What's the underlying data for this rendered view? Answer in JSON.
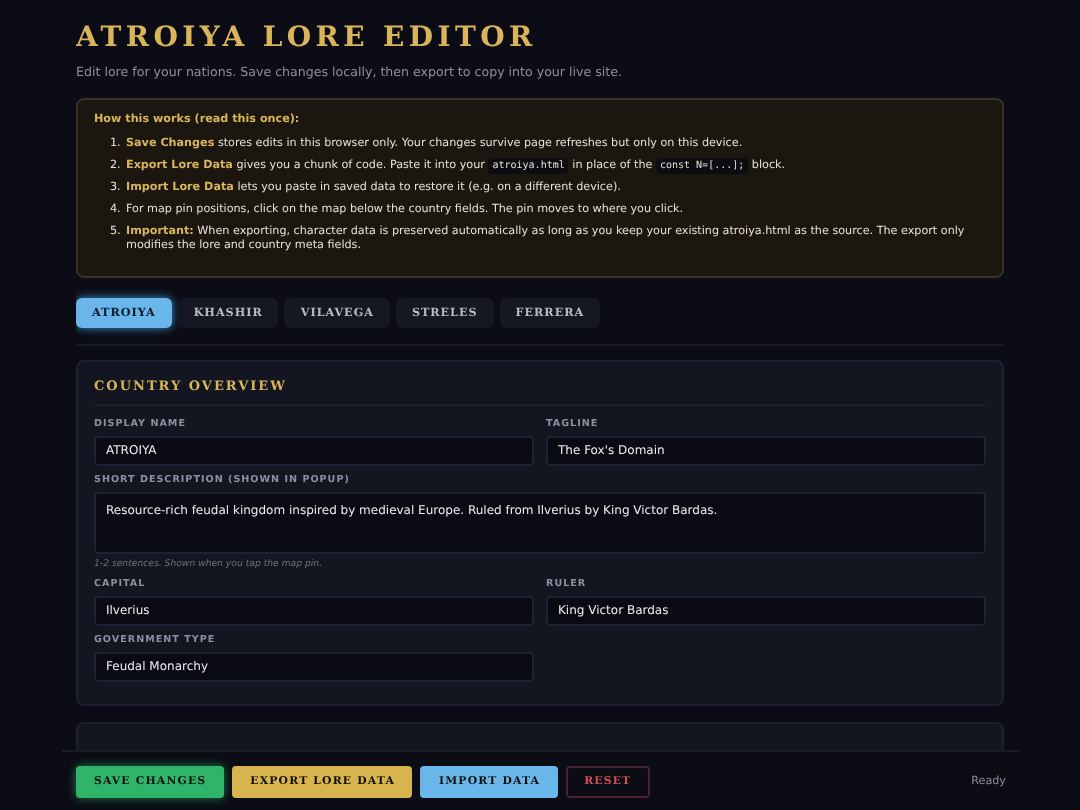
{
  "header": {
    "title": "ATROIYA LORE EDITOR",
    "subtitle": "Edit lore for your nations. Save changes locally, then export to copy into your live site."
  },
  "info": {
    "heading": "How this works (read this once):",
    "items": [
      {
        "marker": "1.",
        "segments": [
          {
            "kind": "strong",
            "text": "Save Changes"
          },
          {
            "kind": "text",
            "text": " stores edits in this browser only. Your changes survive page refreshes but only on this device."
          }
        ]
      },
      {
        "marker": "2.",
        "segments": [
          {
            "kind": "strong",
            "text": "Export Lore Data"
          },
          {
            "kind": "text",
            "text": " gives you a chunk of code. Paste it into your "
          },
          {
            "kind": "code",
            "text": "atroiya.html"
          },
          {
            "kind": "text",
            "text": " in place of the "
          },
          {
            "kind": "code",
            "text": "const N=[...];"
          },
          {
            "kind": "text",
            "text": " block."
          }
        ]
      },
      {
        "marker": "3.",
        "segments": [
          {
            "kind": "strong",
            "text": "Import Lore Data"
          },
          {
            "kind": "text",
            "text": " lets you paste in saved data to restore it (e.g. on a different device)."
          }
        ]
      },
      {
        "marker": "4.",
        "segments": [
          {
            "kind": "text",
            "text": "For map pin positions, click on the map below the country fields. The pin moves to where you click."
          }
        ]
      },
      {
        "marker": "5.",
        "segments": [
          {
            "kind": "strong",
            "text": "Important:"
          },
          {
            "kind": "text",
            "text": " When exporting, character data is preserved automatically as long as you keep your existing atroiya.html as the source. The export only modifies the lore and country meta fields."
          }
        ]
      }
    ]
  },
  "tabs": [
    {
      "label": "ATROIYA",
      "selected": true
    },
    {
      "label": "KHASHIR",
      "selected": false
    },
    {
      "label": "VILAVEGA",
      "selected": false
    },
    {
      "label": "STRELES",
      "selected": false
    },
    {
      "label": "FERRERA",
      "selected": false
    }
  ],
  "overview": {
    "title": "COUNTRY OVERVIEW",
    "fields": [
      {
        "kind": "input",
        "label": "DISPLAY NAME",
        "value": "ATROIYA"
      },
      {
        "kind": "input",
        "label": "TAGLINE",
        "value": "The Fox's Domain"
      },
      {
        "kind": "textarea",
        "label": "SHORT DESCRIPTION (SHOWN IN POPUP)",
        "value": "Resource-rich feudal kingdom inspired by medieval Europe. Ruled from Ilverius by King Victor Bardas.",
        "hint": "1-2 sentences. Shown when you tap the map pin."
      },
      {
        "kind": "input",
        "label": "CAPITAL",
        "value": "Ilverius"
      },
      {
        "kind": "input",
        "label": "RULER",
        "value": "King Victor Bardas"
      },
      {
        "kind": "input",
        "label": "GOVERNMENT TYPE",
        "value": "Feudal Monarchy"
      }
    ]
  },
  "actions": [
    {
      "kind": "save",
      "label": "SAVE CHANGES"
    },
    {
      "kind": "export",
      "label": "EXPORT LORE DATA"
    },
    {
      "kind": "import",
      "label": "IMPORT DATA"
    },
    {
      "kind": "reset",
      "label": "RESET"
    }
  ],
  "status": "Ready"
}
